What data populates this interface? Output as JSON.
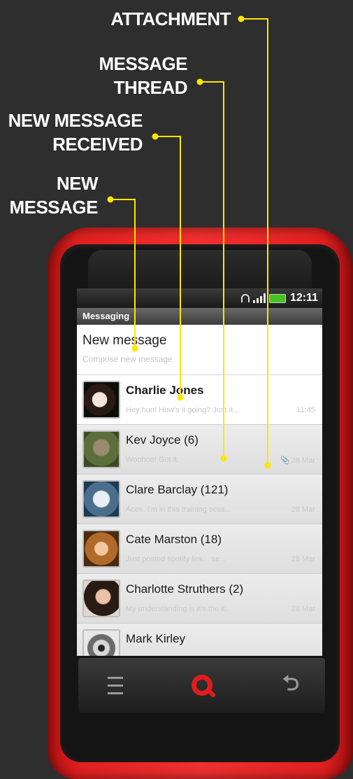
{
  "callouts": {
    "attachment": "ATTACHMENT",
    "message_thread": [
      "MESSAGE",
      "THREAD"
    ],
    "new_message_received": [
      "NEW MESSAGE",
      "RECEIVED"
    ],
    "new_message": [
      "NEW",
      "MESSAGE"
    ]
  },
  "status_bar": {
    "time": "12:11"
  },
  "app": {
    "title": "Messaging"
  },
  "compose": {
    "title": "New message",
    "subtitle": "Compose new message"
  },
  "threads": [
    {
      "name": "Charlie Jones",
      "preview": "Hey hun! How's it going? Just it...",
      "date": "11:45",
      "unread": true,
      "attachment": false
    },
    {
      "name": "Kev Joyce (6)",
      "preview": "Woohoo! Got it.",
      "date": "28 Mar",
      "unread": false,
      "attachment": true
    },
    {
      "name": "Clare Barclay (121)",
      "preview": "Aces. I'm in this training sess...",
      "date": "28 Mar",
      "unread": false,
      "attachment": false
    },
    {
      "name": "Cate Marston (18)",
      "preview": "Just posted spotify link... se...",
      "date": "28 Mar",
      "unread": false,
      "attachment": false
    },
    {
      "name": "Charlotte Struthers (2)",
      "preview": "My understanding is it's the it...",
      "date": "28 Mar",
      "unread": false,
      "attachment": false
    },
    {
      "name": "Mark Kirley",
      "preview": "",
      "date": "",
      "unread": false,
      "attachment": false
    }
  ],
  "nav": {
    "menu_icon": "menu-icon",
    "search_icon": "search-icon",
    "back_icon": "back-icon"
  },
  "colors": {
    "phone_red": "#e22020",
    "callout_yellow": "#ffe600",
    "background": "#2e2e2e",
    "battery_green": "#46c41e"
  }
}
